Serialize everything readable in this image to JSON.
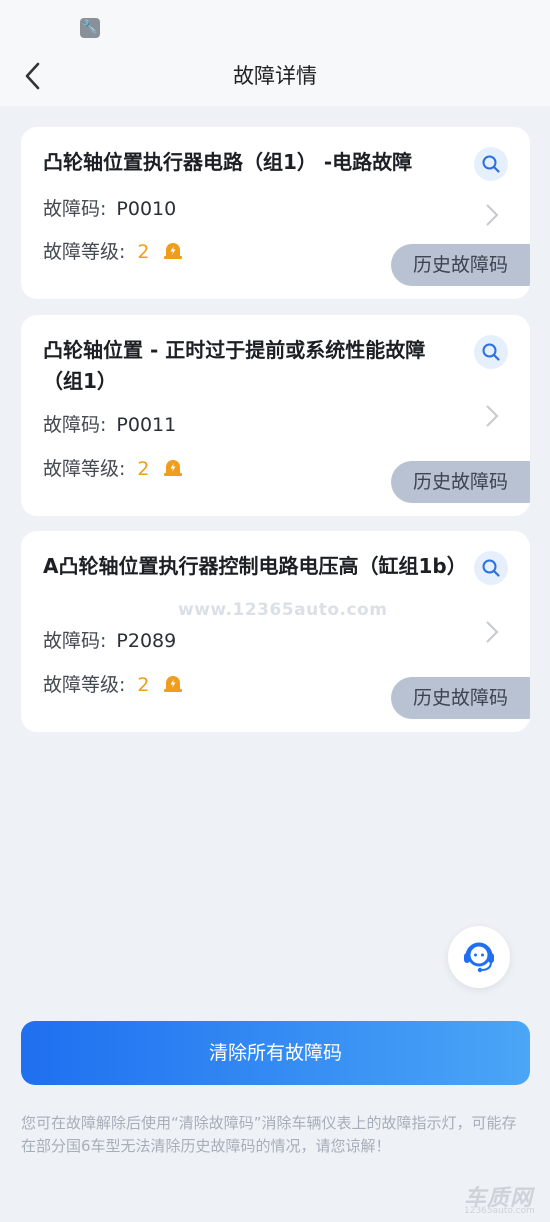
{
  "header": {
    "title": "故障详情"
  },
  "faults": [
    {
      "title": "凸轮轴位置执行器电路（组1） -电路故障",
      "code_label": "故障码:",
      "code": "P0010",
      "level_label": "故障等级:",
      "level": "2",
      "history_label": "历史故障码"
    },
    {
      "title": "凸轮轴位置 - 正时过于提前或系统性能故障（组1）",
      "code_label": "故障码:",
      "code": "P0011",
      "level_label": "故障等级:",
      "level": "2",
      "history_label": "历史故障码"
    },
    {
      "title": "A凸轮轴位置执行器控制电路电压高（缸组1b）",
      "code_label": "故障码:",
      "code": "P2089",
      "level_label": "故障等级:",
      "level": "2",
      "history_label": "历史故障码"
    }
  ],
  "actions": {
    "clear_all_label": "清除所有故障码"
  },
  "notice": "您可在故障解除后使用“清除故障码”消除车辆仪表上的故障指示灯，可能存在部分国6车型无法清除历史故障码的情况，请您谅解！",
  "watermark": "www.12365auto.com",
  "brand": {
    "name": "车质网",
    "url": "12365auto.com"
  },
  "colors": {
    "accent": "#1f6ff0",
    "level": "#ef9d1a",
    "history_bg": "#b8c2d2"
  },
  "icons": {
    "status": "wrench-icon",
    "back": "back-arrow-icon",
    "search": "search-icon",
    "chevron": "chevron-right-icon",
    "warning": "warning-light-icon",
    "support": "customer-service-icon"
  }
}
